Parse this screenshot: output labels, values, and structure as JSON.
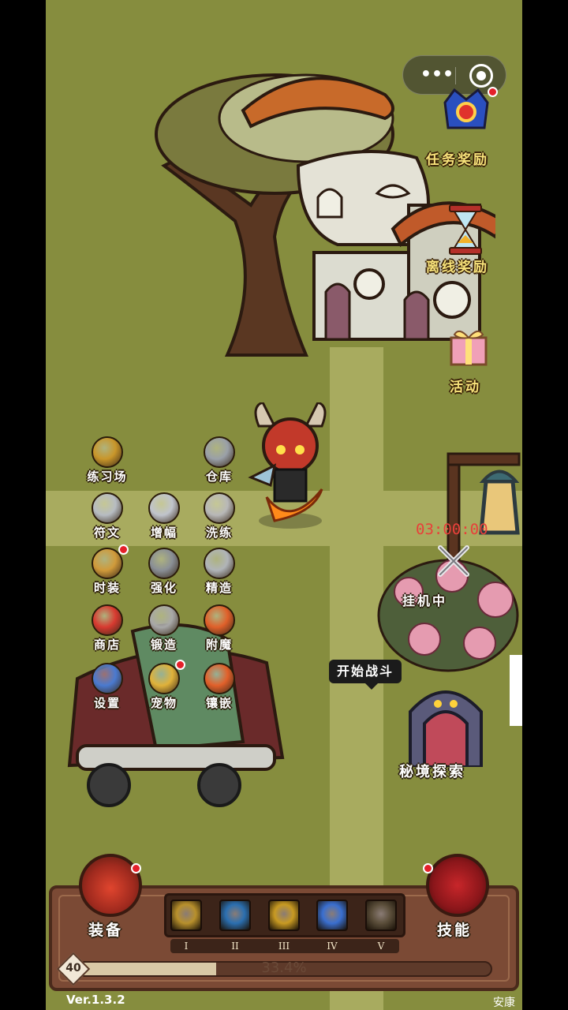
{
  "hud": {
    "menu_dots": "•••",
    "quest_reward": "任务奖励",
    "offline_reward": "离线奖励",
    "event": "活动",
    "timer": "03:00:00",
    "idle_status": "挂机中",
    "start_battle": "开始战斗",
    "secret_realm": "秘境探索"
  },
  "menu": [
    {
      "id": "training",
      "label": "练习场",
      "icon": "shield-badge-icon"
    },
    {
      "id": "warehouse",
      "label": "仓库",
      "icon": "chest-icon"
    },
    {
      "id": "rune",
      "label": "符文",
      "icon": "rune-stone-icon"
    },
    {
      "id": "amplify",
      "label": "增幅",
      "icon": "crystal-icon"
    },
    {
      "id": "refine",
      "label": "洗练",
      "icon": "flask-icon"
    },
    {
      "id": "fashion",
      "label": "时装",
      "icon": "costume-icon"
    },
    {
      "id": "enhance",
      "label": "强化",
      "icon": "scroll-icon"
    },
    {
      "id": "craft",
      "label": "精造",
      "icon": "helmet-icon"
    },
    {
      "id": "shop",
      "label": "商店",
      "icon": "shop-icon"
    },
    {
      "id": "forge",
      "label": "锻造",
      "icon": "anvil-icon"
    },
    {
      "id": "enchant",
      "label": "附魔",
      "icon": "fire-icon"
    },
    {
      "id": "settings",
      "label": "设置",
      "icon": "gear-icon"
    },
    {
      "id": "pet",
      "label": "宠物",
      "icon": "pet-icon"
    },
    {
      "id": "inlay",
      "label": "镶嵌",
      "icon": "gem-icon"
    }
  ],
  "bottom": {
    "equip_label": "装备",
    "skill_label": "技能",
    "skills": [
      {
        "numeral": "I",
        "icon": "shield-skill-icon",
        "color": "#b8902c"
      },
      {
        "numeral": "II",
        "icon": "ice-rune-skill-icon",
        "color": "#2b6fb0"
      },
      {
        "numeral": "III",
        "icon": "golden-flame-skill-icon",
        "color": "#c89a22"
      },
      {
        "numeral": "IV",
        "icon": "whirlwind-skill-icon",
        "color": "#3a6fd0"
      },
      {
        "numeral": "V",
        "icon": "hooded-figure-skill-icon",
        "color": "#5b4e3a"
      }
    ],
    "level": "40",
    "xp_percent_text": "33.4%",
    "xp_fraction": 0.334
  },
  "footer": {
    "version": "Ver.1.3.2",
    "carrier": "安康"
  }
}
